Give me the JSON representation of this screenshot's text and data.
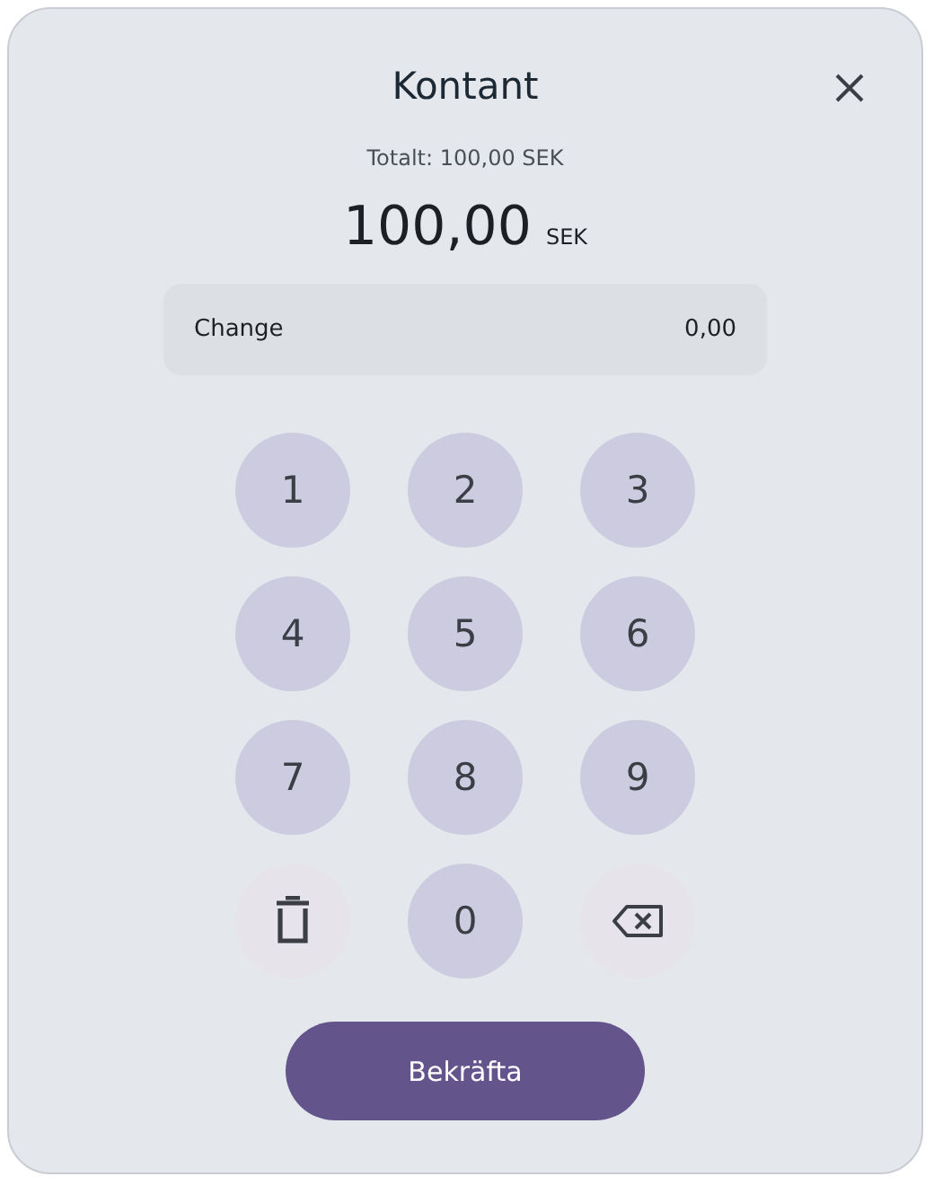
{
  "dialog": {
    "title": "Kontant",
    "total": "Totalt: 100,00 SEK",
    "amount": "100,00",
    "currency": "SEK"
  },
  "change": {
    "label": "Change",
    "value": "0,00"
  },
  "keys": [
    {
      "kind": "digit",
      "label": "1"
    },
    {
      "kind": "digit",
      "label": "2"
    },
    {
      "kind": "digit",
      "label": "3"
    },
    {
      "kind": "digit",
      "label": "4"
    },
    {
      "kind": "digit",
      "label": "5"
    },
    {
      "kind": "digit",
      "label": "6"
    },
    {
      "kind": "digit",
      "label": "7"
    },
    {
      "kind": "digit",
      "label": "8"
    },
    {
      "kind": "digit",
      "label": "9"
    },
    {
      "kind": "clear"
    },
    {
      "kind": "digit",
      "label": "0"
    },
    {
      "kind": "backspace"
    }
  ],
  "confirm": "Bekräfta"
}
